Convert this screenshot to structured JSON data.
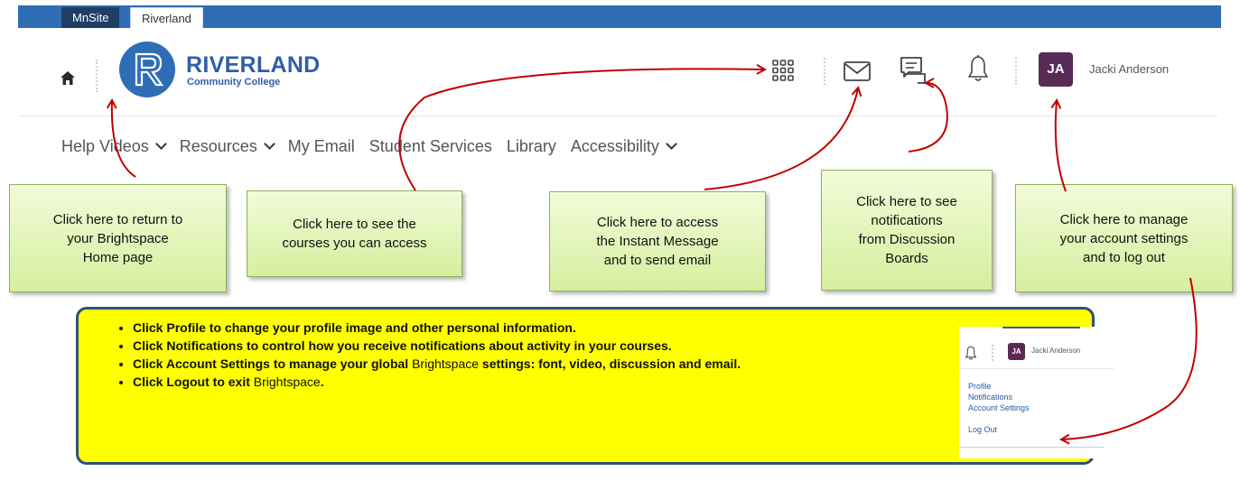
{
  "site_tabs": [
    {
      "label": "MnSite"
    },
    {
      "label": "Riverland"
    }
  ],
  "header": {
    "logo_letter": "R",
    "logo_name": "RIVERLAND",
    "logo_subtitle": "Community College",
    "user_initials": "JA",
    "user_name": "Jacki Anderson",
    "icons": [
      "home-icon",
      "waffle-grid-icon",
      "mail-icon",
      "chat-icon",
      "bell-icon"
    ]
  },
  "nav": {
    "items": [
      {
        "label": "Help Videos",
        "has_dropdown": true
      },
      {
        "label": "Resources",
        "has_dropdown": true
      },
      {
        "label": "My Email",
        "has_dropdown": false
      },
      {
        "label": "Student Services",
        "has_dropdown": false
      },
      {
        "label": "Library",
        "has_dropdown": false
      },
      {
        "label": "Accessibility",
        "has_dropdown": true
      }
    ]
  },
  "callouts": [
    {
      "lines": [
        "Click here to return to",
        "your Brightspace",
        "Home page"
      ]
    },
    {
      "lines": [
        "Click here to see the",
        "courses you can access"
      ]
    },
    {
      "lines": [
        "Click here to access",
        "the Instant Message",
        "and to send email"
      ]
    },
    {
      "lines": [
        "Click here to see",
        "notifications",
        "from Discussion",
        "Boards"
      ]
    },
    {
      "lines": [
        "Click here to manage",
        "your account settings",
        "and to log out"
      ]
    }
  ],
  "info": {
    "items": [
      {
        "bold_start": "Click Profile to change your profile image and other personal information.",
        "normal": "",
        "bold_end": ""
      },
      {
        "bold_start": "Click Notifications to control how you receive notifications about activity in your courses.",
        "normal": "",
        "bold_end": ""
      },
      {
        "bold_start": "Click Account Settings to manage your global ",
        "normal": "Brightspace",
        "bold_end": " settings: font, video, discussion and email."
      },
      {
        "bold_start": "Click Logout to exit ",
        "normal": "Brightspace",
        "bold_end": "."
      }
    ]
  },
  "mini_menu": {
    "user_initials": "JA",
    "user_name": "Jacki Anderson",
    "items": [
      "Profile",
      "Notifications",
      "Account Settings",
      "Log Out"
    ]
  },
  "colors": {
    "top_bar": "#2e6db4",
    "brand_blue": "#2f5fa7",
    "avatar": "#5a2a57",
    "arrow_red": "#c00000",
    "info_bg": "#ffff00",
    "callout_green": "#d5ef9e"
  }
}
